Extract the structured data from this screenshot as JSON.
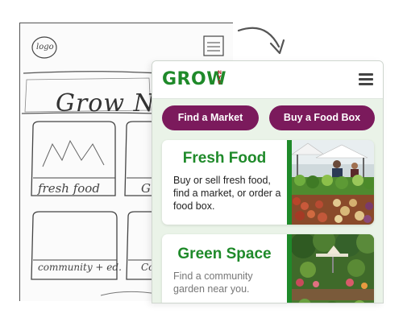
{
  "sketch": {
    "logo_label": "logo",
    "title": "Grow NYC",
    "card1_label": "fresh food",
    "card2_label": "community + ed.",
    "card3_fragment": "Gr",
    "card4_fragment": "Co"
  },
  "app": {
    "logo_text": "GROW",
    "logo_sub": [
      "N",
      "Y",
      "C"
    ]
  },
  "buttons": {
    "find_market": "Find a Market",
    "buy_food_box": "Buy a Food Box"
  },
  "cards": [
    {
      "title": "Fresh Food",
      "description": "Buy or sell fresh food, find a market, or order a food box."
    },
    {
      "title": "Green Space",
      "description": "Find a community garden near you."
    }
  ],
  "colors": {
    "brand_green": "#1f8a2a",
    "button_purple": "#7b1a5c",
    "logo_red": "#b3202b",
    "page_tint": "#eaf3e8"
  },
  "icons": {
    "menu": "hamburger-menu-icon",
    "arrow": "curved-arrow-icon"
  }
}
